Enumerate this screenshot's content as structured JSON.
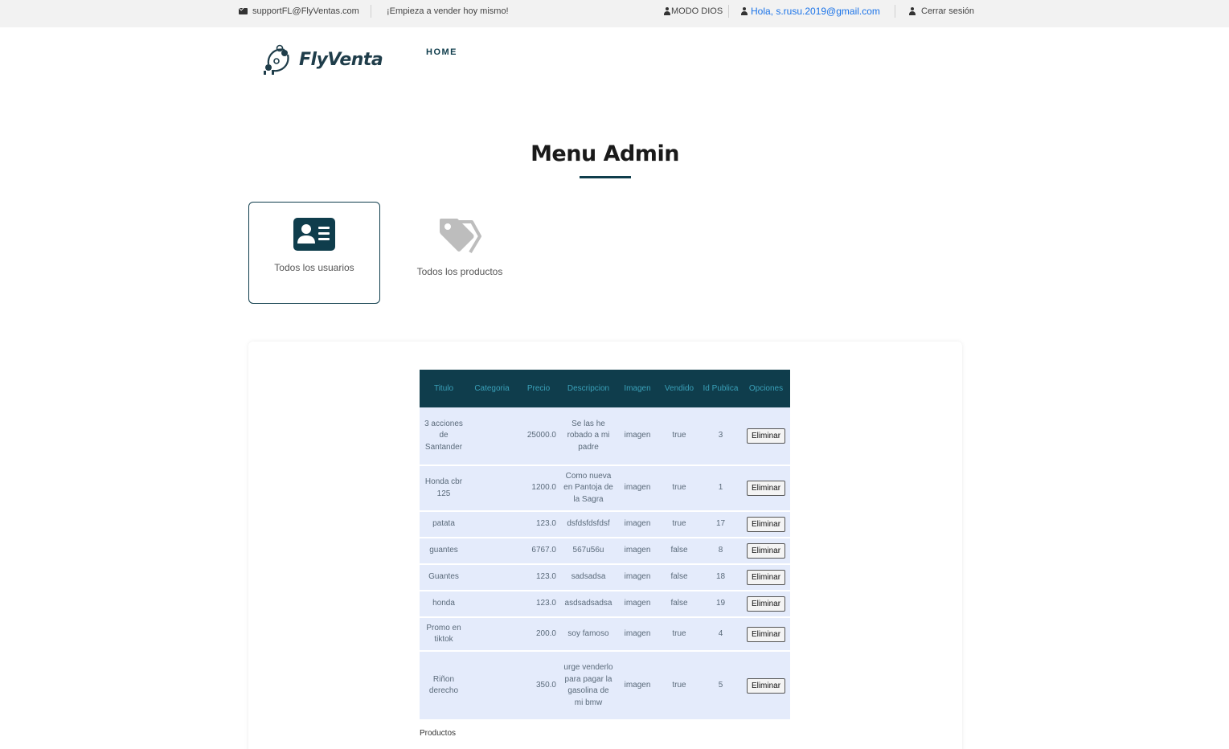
{
  "topbar": {
    "support_email": "supportFL@FlyVentas.com",
    "slogan": "¡Empieza a vender hoy mismo!",
    "god_mode": "MODO DIOS",
    "greeting": "Hola, s.rusu.2019@gmail.com",
    "logout": "Cerrar sesión"
  },
  "header": {
    "brand": "FlyVenta",
    "nav_home": "HOME"
  },
  "page": {
    "title": "Menu Admin"
  },
  "cards": {
    "users": {
      "label": "Todos los usuarios",
      "icon": "id-card-icon"
    },
    "products": {
      "label": "Todos los productos",
      "icon": "tags-icon"
    }
  },
  "colors": {
    "accent": "#0f3d4c",
    "header_text": "#3aa0b8",
    "row_bg": "#e4ebfb",
    "link": "#1a73e8"
  },
  "table": {
    "headers": [
      "Titulo",
      "Categoria",
      "Precio",
      "Descripcion",
      "Imagen",
      "Vendido",
      "Id Publica",
      "Opciones"
    ],
    "delete_label": "Eliminar",
    "caption": "Productos",
    "rows": [
      {
        "titulo": "3 acciones de Santander",
        "categoria": "",
        "precio": "25000.0",
        "descripcion": "Se las he robado a mi padre",
        "imagen": "imagen",
        "vendido": "true",
        "id": "3"
      },
      {
        "titulo": "Honda cbr 125",
        "categoria": "",
        "precio": "1200.0",
        "descripcion": "Como nueva en Pantoja de la Sagra",
        "imagen": "imagen",
        "vendido": "true",
        "id": "1"
      },
      {
        "titulo": "patata",
        "categoria": "",
        "precio": "123.0",
        "descripcion": "dsfdsfdsfdsf",
        "imagen": "imagen",
        "vendido": "true",
        "id": "17"
      },
      {
        "titulo": "guantes",
        "categoria": "",
        "precio": "6767.0",
        "descripcion": "567u56u",
        "imagen": "imagen",
        "vendido": "false",
        "id": "8"
      },
      {
        "titulo": "Guantes",
        "categoria": "",
        "precio": "123.0",
        "descripcion": "sadsadsa",
        "imagen": "imagen",
        "vendido": "false",
        "id": "18"
      },
      {
        "titulo": "honda",
        "categoria": "",
        "precio": "123.0",
        "descripcion": "asdsadsadsa",
        "imagen": "imagen",
        "vendido": "false",
        "id": "19"
      },
      {
        "titulo": "Promo en tiktok",
        "categoria": "",
        "precio": "200.0",
        "descripcion": "soy famoso",
        "imagen": "imagen",
        "vendido": "true",
        "id": "4"
      },
      {
        "titulo": "Riñon derecho",
        "categoria": "",
        "precio": "350.0",
        "descripcion": "urge venderlo para pagar la gasolina de mi bmw",
        "imagen": "imagen",
        "vendido": "true",
        "id": "5"
      }
    ]
  }
}
